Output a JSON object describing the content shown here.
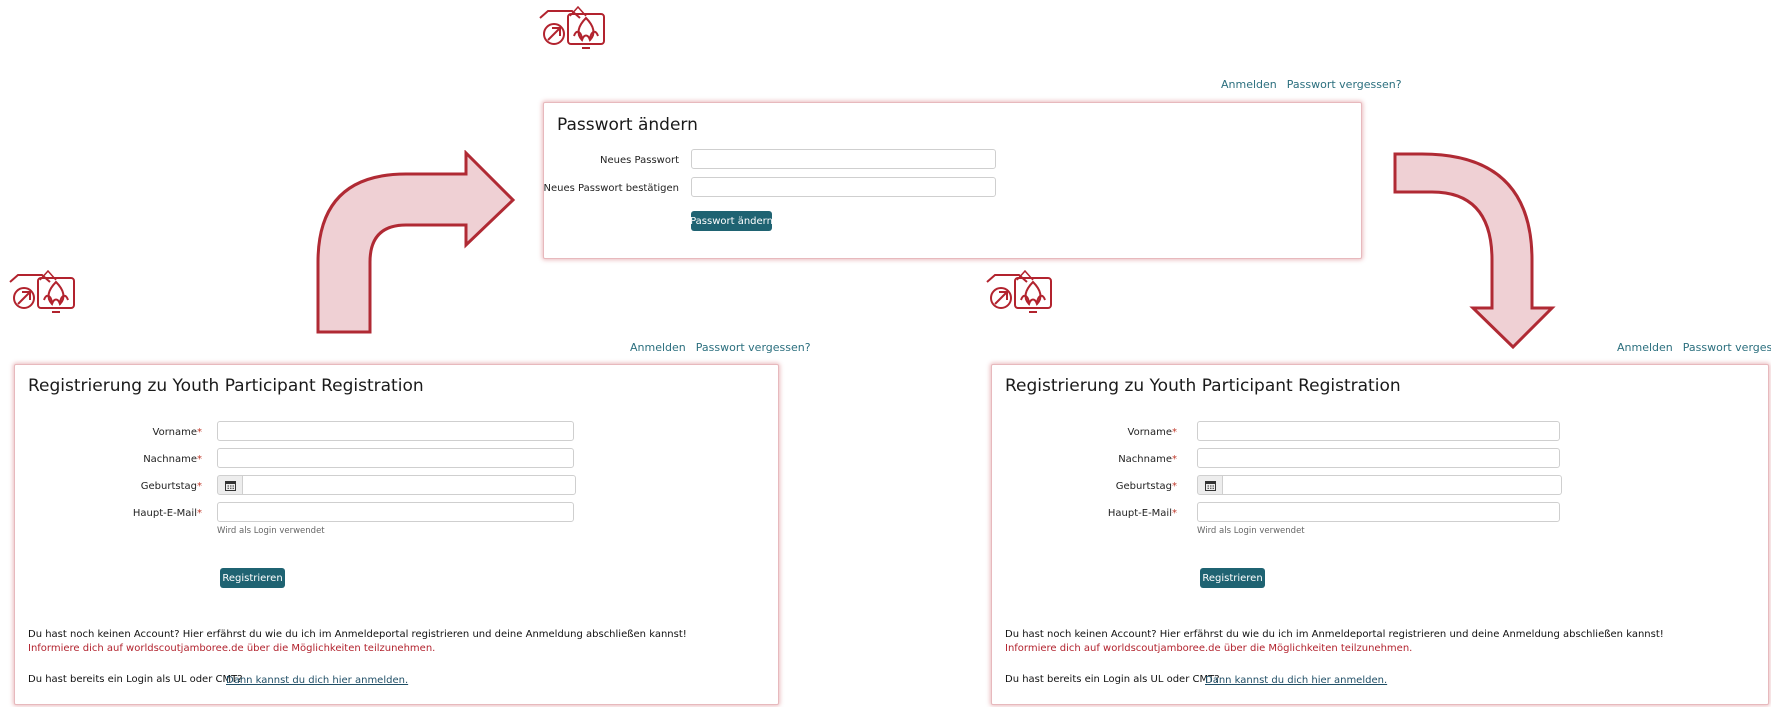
{
  "top": {
    "links": [
      "Anmelden",
      "Passwort vergessen?"
    ],
    "card": {
      "title": "Passwort ändern",
      "new_password_label": "Neues Passwort",
      "confirm_password_label": "Neues Passwort bestätigen",
      "submit_label": "Passwort ändern"
    }
  },
  "registration": {
    "links": [
      "Anmelden",
      "Passwort vergessen?"
    ],
    "title": "Registrierung zu Youth Participant Registration",
    "fields": {
      "first_name_label": "Vorname",
      "last_name_label": "Nachname",
      "birthday_label": "Geburtstag",
      "email_label": "Haupt-E-Mail",
      "required_mark": "*",
      "email_help": "Wird als Login verwendet"
    },
    "submit_label": "Registrieren",
    "info_text": "Du hast noch keinen Account? Hier erfährst du wie du ich im Anmeldeportal registrieren und deine Anmeldung abschließen kannst!",
    "info_link_text": "Informiere dich auf worldscoutjamboree.de über die Möglichkeiten teilzunehmen.",
    "login_prompt": "Du hast bereits ein Login als UL oder CMT?",
    "login_link": "Dann kannst du dich hier anmelden."
  },
  "colors": {
    "accent": "#1f6372",
    "brand_red": "#b2232e",
    "arrow_fill": "#efd0d4",
    "arrow_stroke": "#b02a34",
    "link": "#2b6f7e"
  },
  "icons": [
    "scout-logo",
    "calendar-icon",
    "curved-arrow-right",
    "curved-arrow-down"
  ]
}
